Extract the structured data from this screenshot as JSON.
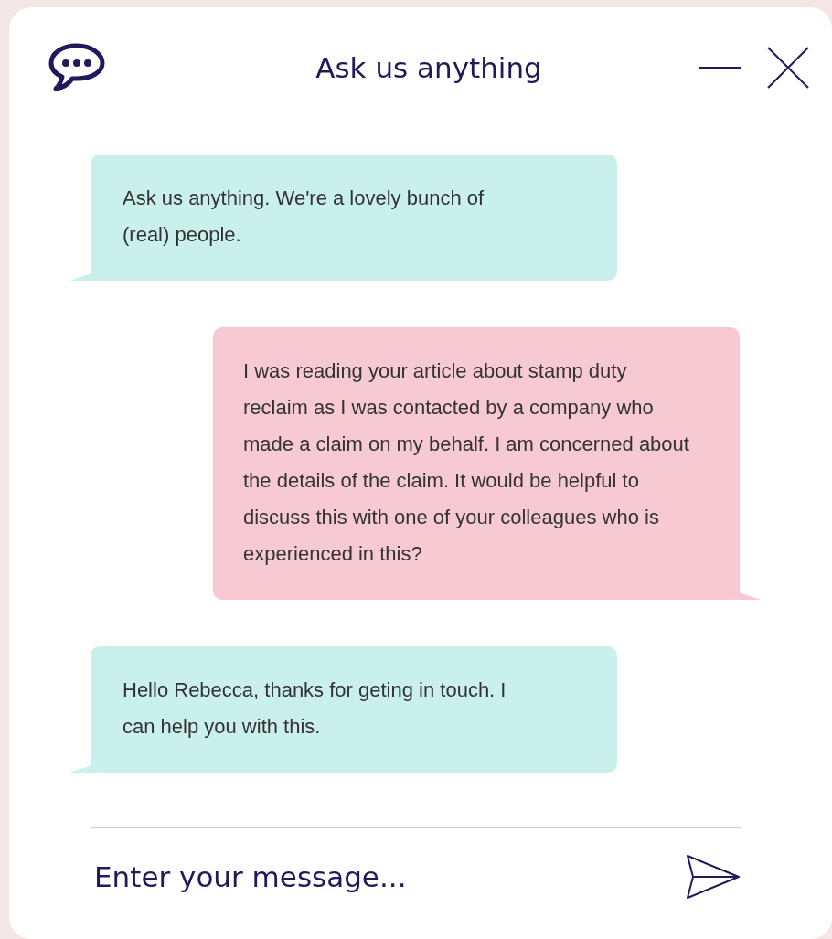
{
  "header": {
    "title": "Ask us anything"
  },
  "messages": [
    {
      "kind": "agent",
      "text": "Ask us anything. We're a lovely bunch of (real) people."
    },
    {
      "kind": "user",
      "text": "I was reading your article about stamp duty reclaim as I was contacted by a company who made a claim on my behalf. I am concerned about the details of the claim. It would be helpful to discuss this with one of your colleagues who is experienced in this?"
    },
    {
      "kind": "agent",
      "text": "Hello Rebecca, thanks for geting in touch. I can help you with this."
    }
  ],
  "composer": {
    "placeholder": "Enter your message..."
  }
}
